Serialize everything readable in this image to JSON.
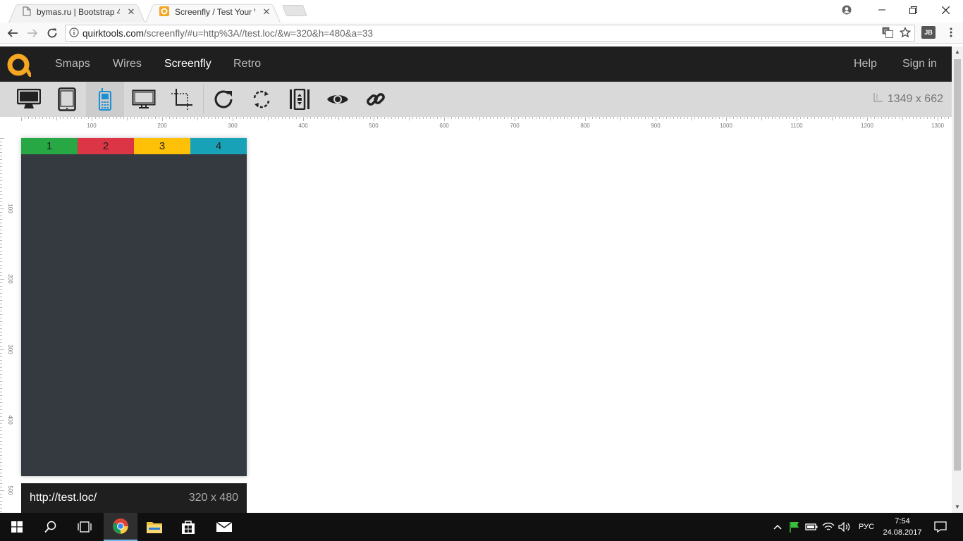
{
  "browser": {
    "tabs": [
      {
        "title": "bymas.ru | Bootstrap 4",
        "active": false
      },
      {
        "title": "Screenfly / Test Your Web",
        "active": true
      }
    ],
    "address": {
      "host": "quirktools.com",
      "path": "/screenfly/#u=http%3A//test.loc/&w=320&h=480&a=33"
    },
    "extension_label": "JB"
  },
  "site": {
    "nav": [
      "Smaps",
      "Wires",
      "Screenfly",
      "Retro"
    ],
    "active_nav": "Screenfly",
    "right_nav": {
      "help": "Help",
      "sign_in": "Sign in"
    }
  },
  "toolbar": {
    "tools": [
      "desktop-icon",
      "tablet-icon",
      "mobile-icon",
      "television-icon",
      "custom-size-icon",
      "refresh-icon",
      "rotate-icon",
      "scroll-toggle-icon",
      "eye-icon",
      "share-link-icon"
    ],
    "selected_tool": "mobile-icon",
    "screen_size": "1349 x 662"
  },
  "rulers": {
    "horizontal_labels": [
      "100",
      "200",
      "300",
      "400",
      "500",
      "600",
      "700",
      "800",
      "900",
      "1000",
      "1100",
      "1200",
      "1300"
    ],
    "vertical_labels": [
      "100",
      "200",
      "300",
      "400",
      "500"
    ]
  },
  "preview": {
    "tabs": [
      {
        "label": "1",
        "color": "#28a745"
      },
      {
        "label": "2",
        "color": "#dc3545"
      },
      {
        "label": "3",
        "color": "#ffc107"
      },
      {
        "label": "4",
        "color": "#17a2b8"
      }
    ],
    "background": "#343a40",
    "url": "http://test.loc/",
    "dimensions": "320 x 480"
  },
  "taskbar": {
    "language": "РУС",
    "time": "7:54",
    "date": "24.08.2017"
  },
  "colors": {
    "accent": "#f5a623",
    "selected_tool": "#1a8fd3",
    "header_bg": "#1f1f1f"
  }
}
